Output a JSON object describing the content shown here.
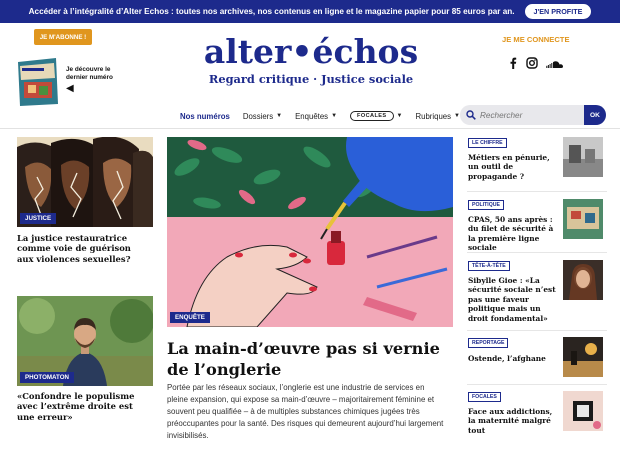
{
  "banner": {
    "text": "Accéder à l’intégralité d’Alter Echos : toutes nos archives, nos contenus en ligne et le magazine papier pour 85 euros par an.",
    "cta": "J'EN PROFITE"
  },
  "header": {
    "subscribe": "JE M'ABONNE !",
    "discover": "Je découvre le dernier numéro",
    "logo": "alter•échos",
    "tagline": "Regard critique · Justice sociale",
    "connect": "JE ME CONNECTE",
    "social_icons": [
      "facebook-icon",
      "instagram-icon",
      "soundcloud-icon"
    ]
  },
  "nav": {
    "items": [
      {
        "label": "Nos numéros",
        "active": true,
        "dropdown": false
      },
      {
        "label": "Dossiers",
        "active": false,
        "dropdown": true
      },
      {
        "label": "Enquêtes",
        "active": false,
        "dropdown": true
      },
      {
        "label": "FOCALES",
        "active": false,
        "dropdown": true
      },
      {
        "label": "Rubriques",
        "active": false,
        "dropdown": true
      }
    ],
    "search_placeholder": "Rechercher",
    "search_button": "OK"
  },
  "left": [
    {
      "tag": "JUSTICE",
      "title": "La justice restauratrice comme voie de guérison aux violences sexuelles?"
    },
    {
      "tag": "PHOTOMATON",
      "title": "«Confondre le populisme avec l’extrême droite est une erreur»"
    }
  ],
  "main": {
    "tag": "ENQUÊTE",
    "title": "La main-d’œuvre pas si vernie de l’onglerie",
    "excerpt": "Portée par les réseaux sociaux, l’onglerie est une industrie de services en pleine expansion, qui expose sa main-d’œuvre – majoritairement féminine et souvent peu qualifiée – à de multiples substances chimiques jugées très préoccupantes pour la santé. Des risques qui demeurent aujourd’hui largement invisibilisés."
  },
  "right": [
    {
      "tag": "LE CHIFFRE",
      "title": "Métiers en pénurie, un outil de propagande ?"
    },
    {
      "tag": "POLITIQUE",
      "title": "CPAS, 50 ans après : du filet de sécurité à la première ligne sociale"
    },
    {
      "tag": "TÊTE-À-TÊTE",
      "title": "Sibylle Gioe : «La sécurité sociale n’est pas une faveur politique mais un droit fondamental»"
    },
    {
      "tag": "REPORTAGE",
      "title": "Ostende, l’afghane"
    },
    {
      "tag": "FOCALES",
      "title": "Face aux addictions, la maternité malgré tout"
    }
  ],
  "colors": {
    "brand": "#1d2a8c",
    "accent": "#e0961e"
  }
}
